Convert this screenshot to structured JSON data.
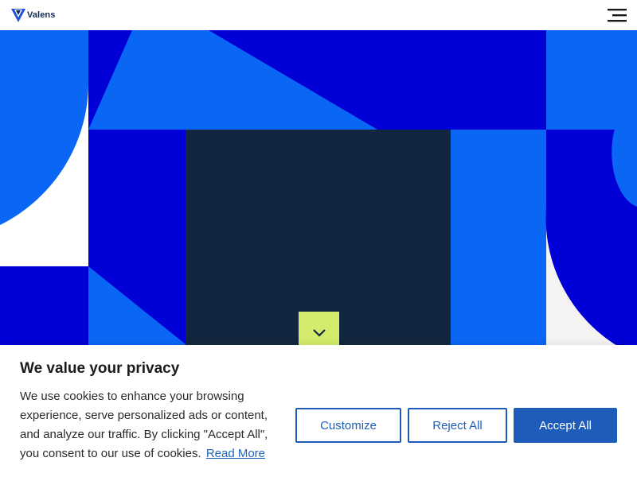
{
  "header": {
    "logo_text": "Valens",
    "logo_icon": "valens-v-logo-icon",
    "menu_icon": "hamburger-menu-icon"
  },
  "hero": {
    "scroll_icon": "chevron-down-icon",
    "colors": {
      "royal_blue": "#0000d6",
      "bright_blue": "#0a66f5",
      "navy": "#13263f",
      "off_white": "#f4f3f1",
      "lime": "#d4ec6b"
    }
  },
  "cookie_banner": {
    "title": "We value your privacy",
    "body": "We use cookies to enhance your browsing experience, serve personalized ads or content, and analyze our traffic. By clicking \"Accept All\", you consent to our use of cookies.",
    "read_more_label": "Read More",
    "customize_label": "Customize",
    "reject_label": "Reject All",
    "accept_label": "Accept All",
    "accent_color": "#1d5cb8"
  }
}
